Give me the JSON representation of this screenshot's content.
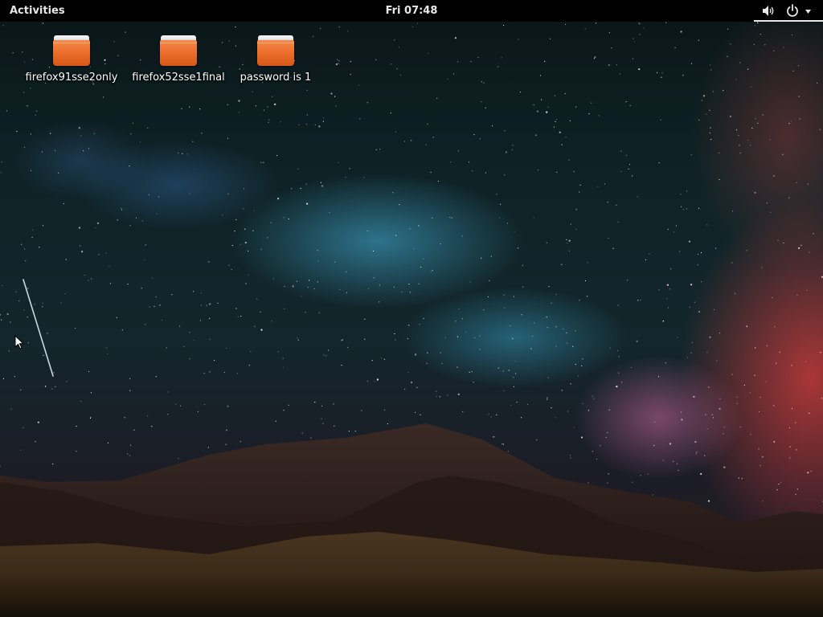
{
  "topbar": {
    "activities_label": "Activities",
    "clock": "Fri 07:48",
    "status": {
      "icons": [
        "volume-icon",
        "power-icon",
        "chevron-down-icon"
      ]
    }
  },
  "desktop": {
    "icons": [
      {
        "label": "firefox91sse2only",
        "icon": "folder-icon"
      },
      {
        "label": "firefox52sse1final",
        "icon": "folder-icon"
      },
      {
        "label": "password is 1",
        "icon": "folder-icon"
      }
    ]
  },
  "colors": {
    "topbar_bg": "#000000",
    "topbar_text": "#e8e8e8",
    "folder_orange": "#ea6a2a",
    "label_text": "#ffffff"
  }
}
